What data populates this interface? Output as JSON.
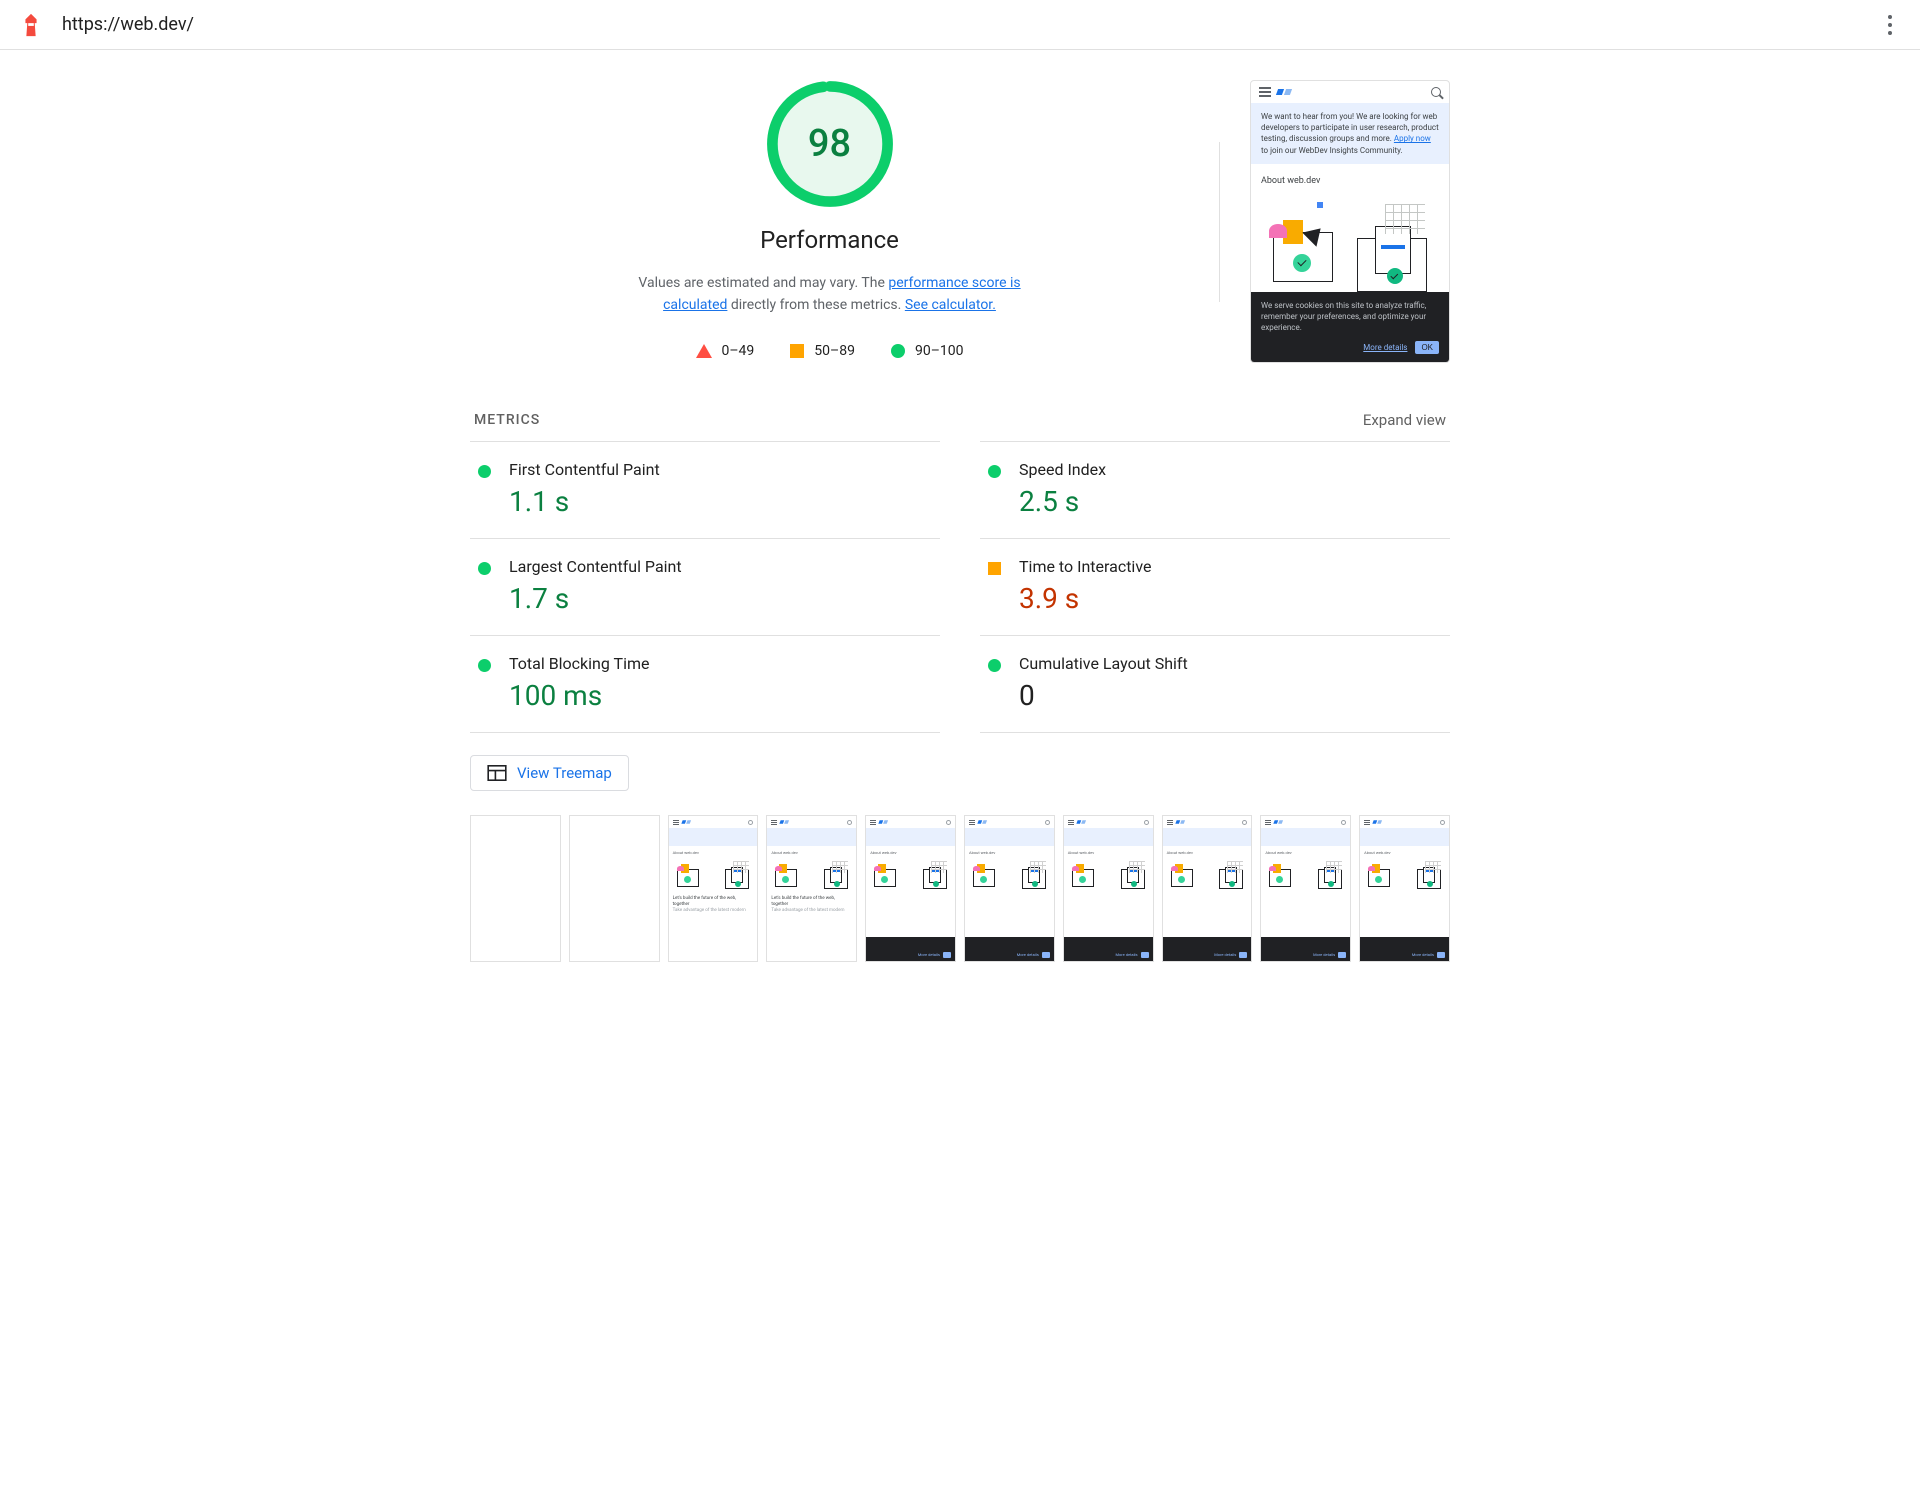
{
  "topbar": {
    "url": "https://web.dev/"
  },
  "gauge": {
    "score": "98",
    "category": "Performance",
    "score_numeric": 98
  },
  "description": {
    "prefix": "Values are estimated and may vary. The ",
    "link1": "performance score is calculated",
    "mid": " directly from these metrics. ",
    "link2": "See calculator."
  },
  "legend": {
    "fail": "0–49",
    "average": "50–89",
    "pass": "90–100"
  },
  "preview": {
    "banner_text": "We want to hear from you! We are looking for web developers to participate in user research, product testing, discussion groups and more. ",
    "banner_link": "Apply now",
    "banner_suffix": " to join our WebDev Insights Community.",
    "about_heading": "About web.dev",
    "cookie_text": "We serve cookies on this site to analyze traffic, remember your preferences, and optimize your experience.",
    "more_details": "More details",
    "ok": "OK"
  },
  "metrics_section": {
    "title": "METRICS",
    "expand": "Expand view"
  },
  "metrics": [
    {
      "name": "First Contentful Paint",
      "value": "1.1 s",
      "status": "green"
    },
    {
      "name": "Speed Index",
      "value": "2.5 s",
      "status": "green"
    },
    {
      "name": "Largest Contentful Paint",
      "value": "1.7 s",
      "status": "green"
    },
    {
      "name": "Time to Interactive",
      "value": "3.9 s",
      "status": "orange"
    },
    {
      "name": "Total Blocking Time",
      "value": "100 ms",
      "status": "green"
    },
    {
      "name": "Cumulative Layout Shift",
      "value": "0",
      "status": "green",
      "neutral_value": true
    }
  ],
  "treemap": {
    "label": "View Treemap"
  },
  "filmstrip": {
    "frames": [
      {
        "state": "blank"
      },
      {
        "state": "blank"
      },
      {
        "state": "partial"
      },
      {
        "state": "partial"
      },
      {
        "state": "cookie"
      },
      {
        "state": "cookie"
      },
      {
        "state": "cookie"
      },
      {
        "state": "cookie"
      },
      {
        "state": "cookie"
      },
      {
        "state": "cookie"
      }
    ]
  },
  "colors": {
    "pass": "#0cce6b",
    "average": "#ffa400",
    "fail": "#ff4e42",
    "link": "#1a73e8"
  }
}
